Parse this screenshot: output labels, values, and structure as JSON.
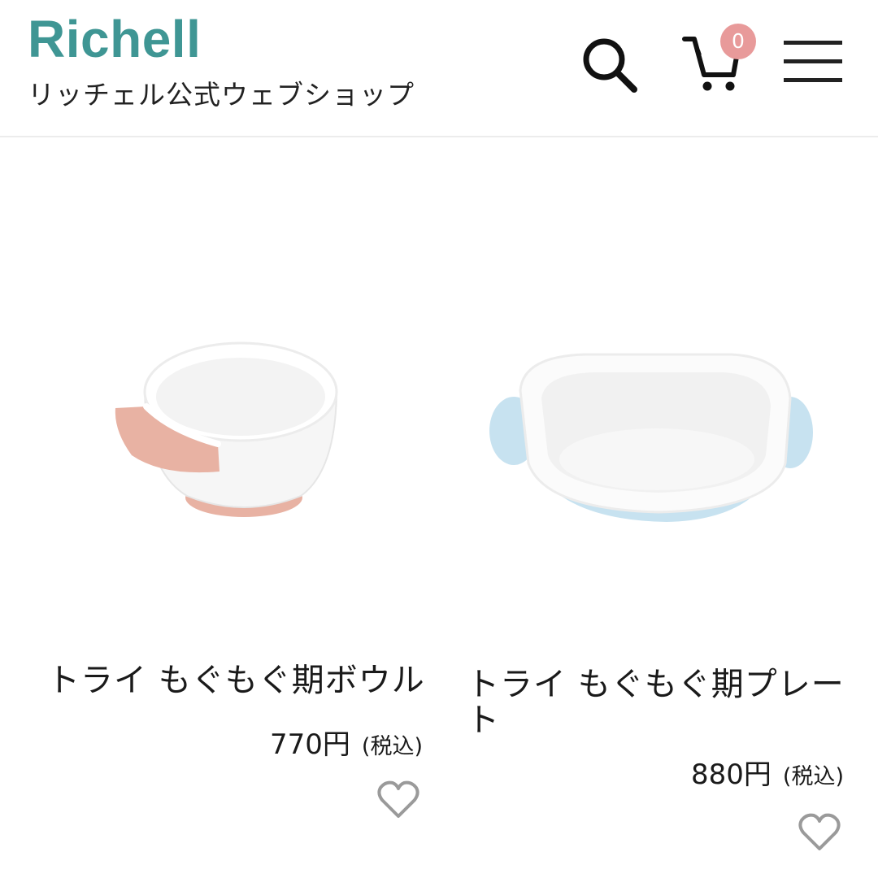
{
  "header": {
    "brand": "Richell",
    "subtitle": "リッチェル公式ウェブショップ",
    "cart_count": "0",
    "icons": {
      "search": "search-icon",
      "cart": "cart-icon",
      "menu": "hamburger-menu-icon"
    }
  },
  "products": [
    {
      "name": "トライ もぐもぐ期ボウル",
      "price": "770円",
      "tax_label": "(税込)",
      "accent_color": "#e8b2a3",
      "image": "bowl-product-image"
    },
    {
      "name": "トライ もぐもぐ期プレート",
      "price": "880円",
      "tax_label": "(税込)",
      "accent_color": "#c7e2f0",
      "image": "plate-product-image"
    }
  ],
  "colors": {
    "brand": "#3f9694",
    "badge": "#e89a9a"
  }
}
